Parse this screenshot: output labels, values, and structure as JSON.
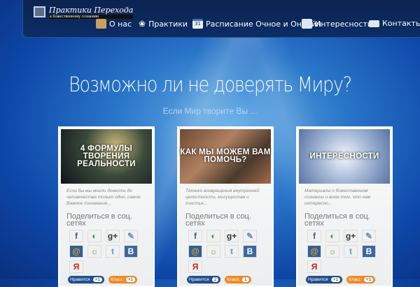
{
  "logo": {
    "title": "Практики Перехода",
    "subtitle": "к божественному сознанию"
  },
  "nav": [
    {
      "label": "О нас",
      "icon": "photo-icon"
    },
    {
      "label": "Практики",
      "icon": "lotus-icon"
    },
    {
      "label": "Расписание Очное и Онлайн",
      "icon": "calendar-icon",
      "icon_text": "31"
    },
    {
      "label": "Интересности",
      "icon": "book-icon"
    },
    {
      "label": "Контакты",
      "icon": "mail-icon"
    }
  ],
  "hero": {
    "title": "Возможно ли не доверять Миру?",
    "subtitle": "Если Мир творите Вы ..."
  },
  "share_heading": "Поделиться в соц. сетях",
  "share_icons": [
    "f",
    "◐",
    "g+",
    "✎",
    "@",
    "☼",
    "t",
    "B",
    "Я"
  ],
  "like_label": "Нравится",
  "klass_label": "Класс",
  "cards": [
    {
      "title": "4 ФОРМУЛЫ ТВОРЕНИЯ РЕАЛЬНОСТИ",
      "desc": "Если бы мы могли донести до человечества только одно, самое Важное понимание...",
      "likes": "+1",
      "klass": "+1"
    },
    {
      "title": "КАК МЫ МОЖЕМ ВАМ ПОМОЧЬ?",
      "desc": "Техники возвращения внутренней целостности, могущества и счастья...",
      "likes": "2",
      "klass": "1"
    },
    {
      "title": "ИНТЕРЕСНОСТИ",
      "desc": "Материалы о божественном сознании и всем том, что нам интересно...",
      "likes": "+1",
      "klass": "+1"
    }
  ]
}
